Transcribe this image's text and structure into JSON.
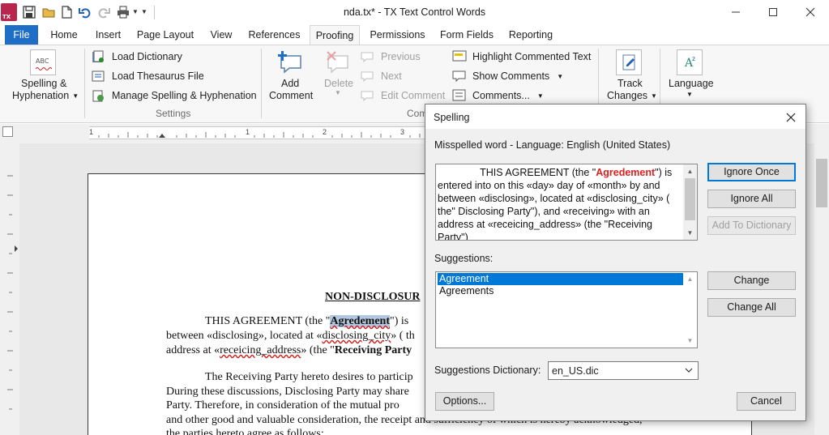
{
  "window": {
    "title": "nda.tx* - TX Text Control Words"
  },
  "ribbon_tabs": [
    "File",
    "Home",
    "Insert",
    "Page Layout",
    "View",
    "References",
    "Proofing",
    "Permissions",
    "Form Fields",
    "Reporting"
  ],
  "ribbon": {
    "spelling": {
      "line1": "Spelling &",
      "line2": "Hyphenation"
    },
    "load_dictionary": "Load Dictionary",
    "load_thesaurus": "Load Thesaurus File",
    "manage_spelling": "Manage Spelling & Hyphenation",
    "settings_group": "Settings",
    "add_comment": {
      "line1": "Add",
      "line2": "Comment"
    },
    "delete": "Delete",
    "previous": "Previous",
    "next": "Next",
    "edit_comment": "Edit Comment",
    "comments_group": "Com",
    "highlight_commented": "Highlight Commented Text",
    "show_comments": "Show Comments",
    "comments": "Comments...",
    "track_changes": {
      "line1": "Track",
      "line2": "Changes"
    },
    "language": "Language",
    "icon_text_abc": "ABC"
  },
  "ruler": {
    "ticks": [
      "1",
      "1",
      "2",
      "3"
    ]
  },
  "document": {
    "heading": "NON-DISCLOSUR",
    "p1_line1_pre": "THIS AGREEMENT (the \"",
    "p1_line1_word": "Agredement",
    "p1_line1_post": "\") is",
    "p1_line2_a": "between «disclosing», located at «",
    "p1_line2_b": "disclosing_city",
    "p1_line2_c": "» ( th",
    "p1_line3_a": "address at «",
    "p1_line3_b": "receicing_address",
    "p1_line3_c": "» (the \"",
    "p1_line3_d": "Receiving Party",
    "p2_line1": "The Receiving Party hereto desires to particip",
    "p2_line2": "During these discussions, Disclosing Party may share",
    "p2_line3": "Party.   Therefore, in consideration of the mutual pro",
    "p2_line4": "and other good and valuable consideration, the receipt and sufficiency of which is hereby acknowledged,",
    "p2_line5": "the parties hereto agree as follows:"
  },
  "dialog": {
    "title": "Spelling",
    "header": "Misspelled word  -  Language: English (United States)",
    "context_pre": "               THIS AGREEMENT (the \"",
    "context_word": "Agredement",
    "context_post": "\") is entered into on this «day» day of «month» by and between «disclosing», located at «disclosing_city» ( the\" Disclosing Party\"), and «receiving» with an address at «receicing_address» (the \"Receiving Party\")",
    "suggestions_label": "Suggestions:",
    "suggestions": [
      "Agreement",
      "Agreements"
    ],
    "dictionary_label": "Suggestions Dictionary:",
    "dictionary_value": "en_US.dic",
    "buttons": {
      "ignore_once": "Ignore Once",
      "ignore_all": "Ignore All",
      "add_to_dictionary": "Add To Dictionary",
      "change": "Change",
      "change_all": "Change All",
      "options": "Options...",
      "cancel": "Cancel"
    }
  },
  "colors": {
    "file_tab": "#1e6ec8",
    "misspelled": "#e02020",
    "selection": "#0078d7",
    "logo": "#b8264e"
  }
}
